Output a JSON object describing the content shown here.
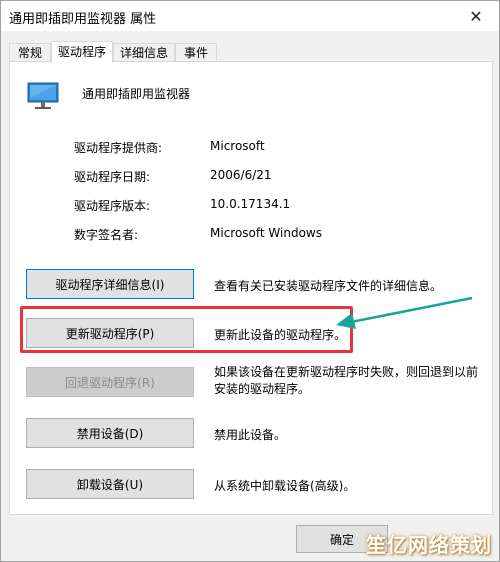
{
  "window": {
    "title": "通用即插即用监视器 属性",
    "close_glyph": "✕"
  },
  "tabs": [
    {
      "label": "常规",
      "active": false
    },
    {
      "label": "驱动程序",
      "active": true
    },
    {
      "label": "详细信息",
      "active": false
    },
    {
      "label": "事件",
      "active": false
    }
  ],
  "device": {
    "name": "通用即插即用监视器",
    "icon": "monitor-icon"
  },
  "info": [
    {
      "label": "驱动程序提供商:",
      "value": "Microsoft"
    },
    {
      "label": "驱动程序日期:",
      "value": "2006/6/21"
    },
    {
      "label": "驱动程序版本:",
      "value": "10.0.17134.1"
    },
    {
      "label": "数字签名者:",
      "value": "Microsoft Windows"
    }
  ],
  "actions": [
    {
      "label": "驱动程序详细信息(I)",
      "description": "查看有关已安装驱动程序文件的详细信息。",
      "enabled": true
    },
    {
      "label": "更新驱动程序(P)",
      "description": "更新此设备的驱动程序。",
      "enabled": true
    },
    {
      "label": "回退驱动程序(R)",
      "description": "如果该设备在更新驱动程序时失败，则回退到以前安装的驱动程序。",
      "enabled": false
    },
    {
      "label": "禁用设备(D)",
      "description": "禁用此设备。",
      "enabled": true
    },
    {
      "label": "卸载设备(U)",
      "description": "从系统中卸载设备(高级)。",
      "enabled": true
    }
  ],
  "footer": {
    "ok_label": "确定"
  },
  "annotation": {
    "highlight_color": "#e8333a",
    "arrow_color": "#1aa39a"
  },
  "watermark": "笙亿网络策划"
}
